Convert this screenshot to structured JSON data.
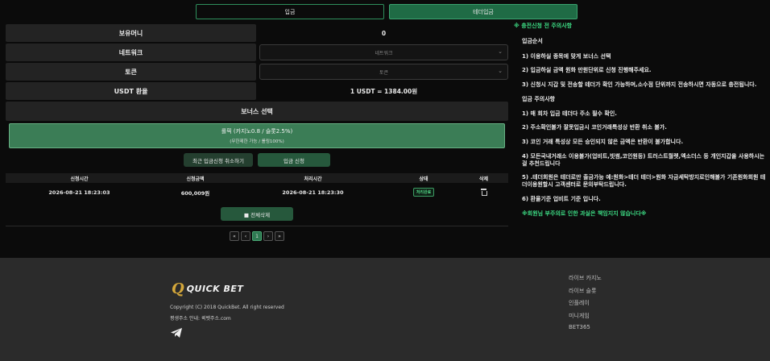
{
  "tabs": [
    {
      "label": "입금"
    },
    {
      "label": "테더입금"
    }
  ],
  "form": {
    "balance_label": "보유머니",
    "balance_value": "0",
    "network_label": "네트워크",
    "network_placeholder": "네트워크",
    "token_label": "토큰",
    "token_placeholder": "토큰",
    "rate_label": "USDT 환율",
    "rate_value": "1 USDT = 1384.00원"
  },
  "bonus": {
    "title": "보너스 선택",
    "option_main": "롤픽 (카지노0.8 / 슬롯2.5%)",
    "option_sub": "(무한제한 가능 / 롤링100%)"
  },
  "actions": {
    "cancel_label": "최근 입금신청 취소하기",
    "apply_label": "입금 신청",
    "delete_all_label": "■ 전체삭제"
  },
  "table": {
    "headers": [
      "신청시간",
      "신청금액",
      "처리시간",
      "상태",
      "삭제"
    ],
    "rows": [
      {
        "requested": "2026-08-21 18:23:03",
        "amount": "600,009원",
        "processed": "2026-08-21 18:23:30",
        "status": "처리완료"
      }
    ]
  },
  "pager": {
    "first": "«",
    "prev": "‹",
    "current": "1",
    "next": "›",
    "last": "»"
  },
  "notice": {
    "title": "※ 충전신청 전 주의사항",
    "order_title": "입금순서",
    "order_items": [
      "1) 이용하실 종목에 맞게 보너스 선택",
      "2) 입금하실 금액 원화 만원단위로 신청 진행해주세요.",
      "3) 신청시 지갑 및 전송할 테더가 확인 가능하며,소수점 단위까지 전송하시면 자동으로 충전됩니다."
    ],
    "caution_title": "입금 주의사항",
    "caution_items": [
      "1) 매 회차 입금 테더다 주소 필수 확인.",
      "2) 주소확인불가 잘못입금시 코인거래특성상 반환 취소 불가.",
      "3) 코인 거래 특성상 모든 승인되지 않은 금액은 반환이 불가합니다.",
      "4) 모든국내거래소 이용불가(업비트,빗썸,코인원등) 트러스트월렛,엑소더스 등 개인지갑을 사용하시는걸 추천드립니다",
      "5) .테더회원은 테더로만 출금가능 예:원화>테더 테더>원화 자금세탁방지로인해불가 기존원화회원 테더이용원할시 고객센터로 문의부탁드립니다.",
      "6) 환율기준 업비트 기준 입니다."
    ],
    "footer_warning": "※회원님 부주의로 인한 과실은 책임지지 않습니다※"
  },
  "footer": {
    "logo_mark": "Q",
    "logo_text": "QUICK BET",
    "copyright": "Copyright (C) 2018 QuickBet. All right reserved",
    "domain_info": "평생주소 안내: 퀵벳주소.com",
    "menu": [
      "라이브 카지노",
      "라이브 슬롯",
      "인플레이",
      "미니게임",
      "BET365"
    ]
  },
  "colors": {
    "accent": "#3ddc84",
    "tab_active": "#1f6b45",
    "button": "#26583c",
    "bonus_box": "#3b7d56",
    "logo_gold": "#d4a73a"
  }
}
